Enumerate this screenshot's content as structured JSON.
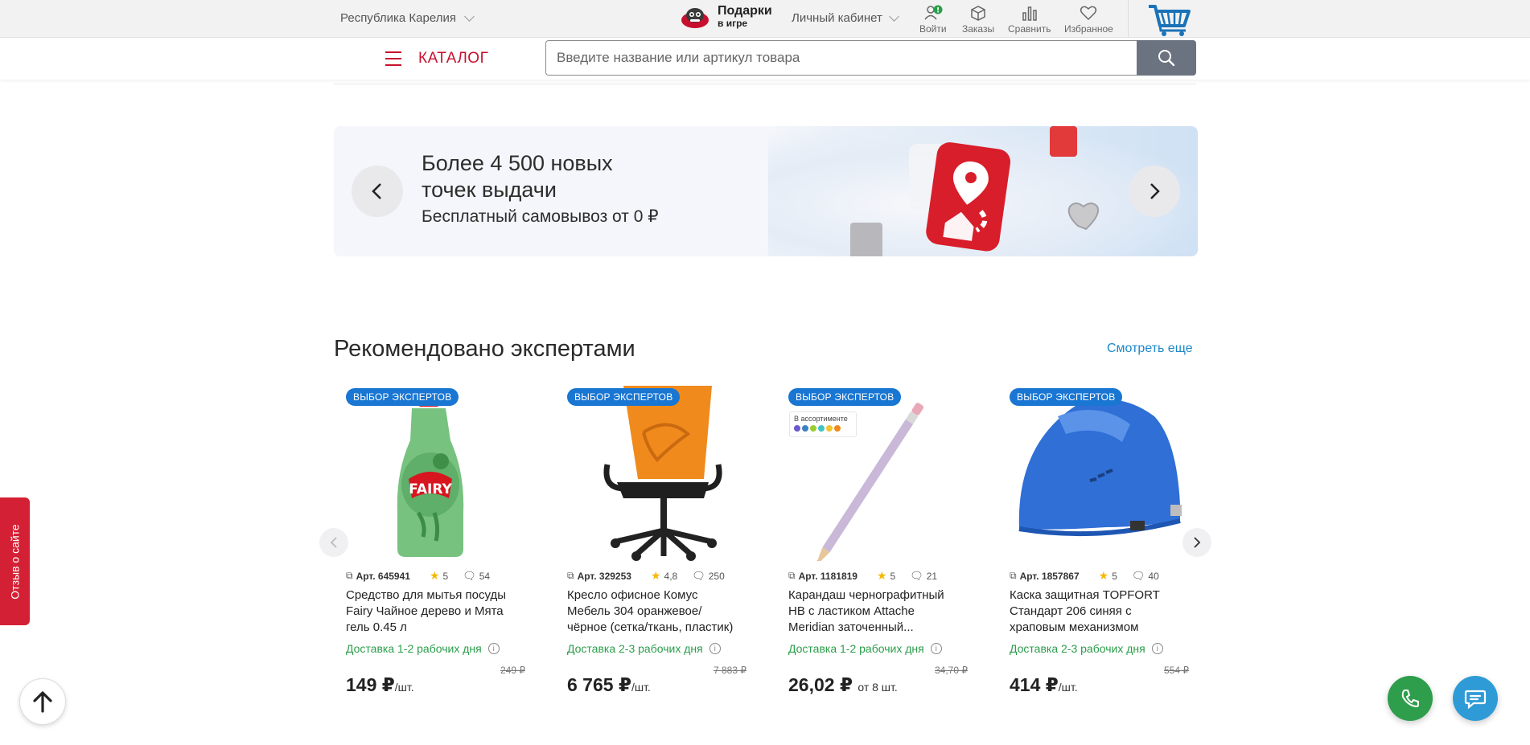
{
  "header": {
    "region": "Республика Карелия",
    "gifts_title": "Подарки",
    "gifts_subtitle": "в игре",
    "cabinet": "Личный кабинет",
    "icons": [
      {
        "label": "Войти",
        "icon": "user-icon",
        "badge": "!"
      },
      {
        "label": "Заказы",
        "icon": "box-icon"
      },
      {
        "label": "Сравнить",
        "icon": "compare-icon"
      },
      {
        "label": "Избранное",
        "icon": "heart-icon"
      }
    ]
  },
  "nav": {
    "catalog": "КАТАЛОГ",
    "search_placeholder": "Введите название или артикул товара"
  },
  "banner": {
    "title": "Более 4 500 новых точек выдачи",
    "subtitle": "Бесплатный самовывоз от 0 ₽"
  },
  "section": {
    "title": "Рекомендовано экспертами",
    "more": "Смотреть еще"
  },
  "products": [
    {
      "badge": "ВЫБОР ЭКСПЕРТОВ",
      "article": "Арт. 645941",
      "rating": "5",
      "reviews": "54",
      "name": "Средство для мытья посуды Fairy Чайное дерево и Мята гель 0.45 л",
      "delivery": "Доставка 1-2 рабочих дня",
      "old_price": "249 ₽",
      "price": "149 ₽",
      "unit": "/шт."
    },
    {
      "badge": "ВЫБОР ЭКСПЕРТОВ",
      "article": "Арт. 329253",
      "rating": "4,8",
      "reviews": "250",
      "name": "Кресло офисное Комус Мебель 304 оранжевое/чёрное (сетка/ткань, пластик)",
      "delivery": "Доставка 2-3 рабочих дня",
      "old_price": "7 883 ₽",
      "price": "6 765 ₽",
      "unit": "/шт."
    },
    {
      "badge": "ВЫБОР ЭКСПЕРТОВ",
      "article": "Арт. 1181819",
      "rating": "5",
      "reviews": "21",
      "name": "Карандаш чернографитный НВ с ластиком Attache Meridian заточенный...",
      "delivery": "Доставка 1-2 рабочих дня",
      "old_price": "34,70 ₽",
      "price": "26,02 ₽",
      "unit": "от 8 шт.",
      "assortment": "В ассортименте"
    },
    {
      "badge": "ВЫБОР ЭКСПЕРТОВ",
      "article": "Арт. 1857867",
      "rating": "5",
      "reviews": "40",
      "name": "Каска защитная TOPFORT Стандарт 206 синяя с храповым механизмом",
      "delivery": "Доставка 2-3 рабочих дня",
      "old_price": "554 ₽",
      "price": "414 ₽",
      "unit": "/шт."
    }
  ],
  "floating": {
    "feedback": "Отзыв о сайте"
  },
  "colors": {
    "brand_red": "#c8102e",
    "badge_blue": "#1976d2",
    "delivery_green": "#2a9d4a",
    "link_blue": "#1e88c9"
  }
}
